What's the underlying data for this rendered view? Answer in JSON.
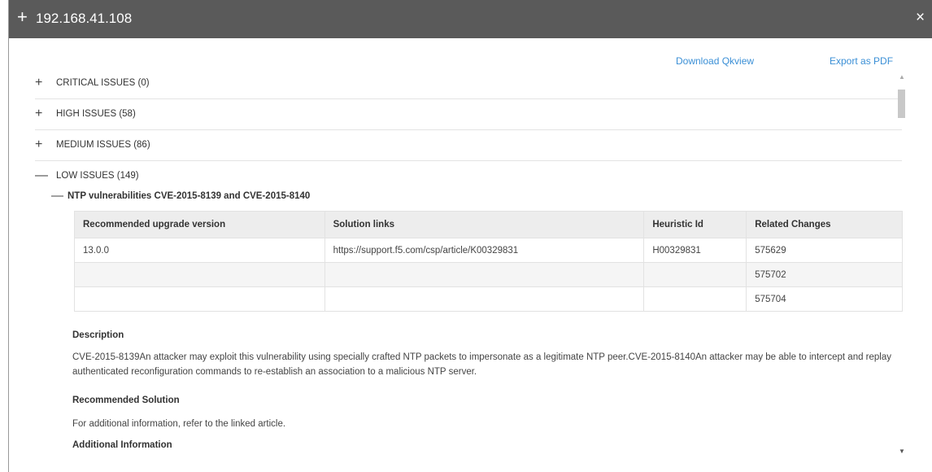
{
  "dialog": {
    "title": "192.168.41.108",
    "expand_symbol": "+",
    "close_symbol": "×"
  },
  "actions": {
    "download_qkview": "Download Qkview",
    "export_pdf": "Export as PDF"
  },
  "sections": {
    "critical": {
      "sign": "+",
      "label": "CRITICAL ISSUES (0)"
    },
    "high": {
      "sign": "+",
      "label": "HIGH ISSUES (58)"
    },
    "medium": {
      "sign": "+",
      "label": "MEDIUM ISSUES (86)"
    },
    "low": {
      "sign": "—",
      "label": "LOW ISSUES (149)"
    }
  },
  "issue": {
    "sign": "—",
    "title": "NTP vulnerabilities CVE-2015-8139 and CVE-2015-8140",
    "table": {
      "headers": [
        "Recommended upgrade version",
        "Solution links",
        "Heuristic Id",
        "Related Changes"
      ],
      "rows": [
        [
          "13.0.0",
          "https://support.f5.com/csp/article/K00329831",
          "H00329831",
          "575629"
        ],
        [
          "",
          "",
          "",
          "575702"
        ],
        [
          "",
          "",
          "",
          "575704"
        ]
      ]
    },
    "description_title": "Description",
    "description_body": "CVE-2015-8139An attacker may exploit this vulnerability using specially crafted NTP packets to impersonate as a legitimate NTP peer.CVE-2015-8140An attacker may be able to intercept and replay authenticated reconfiguration commands to re-establish an association to a malicious NTP server.",
    "recommended_title": "Recommended Solution",
    "recommended_body": "For additional information, refer to the linked article.",
    "additional_title": "Additional Information"
  }
}
